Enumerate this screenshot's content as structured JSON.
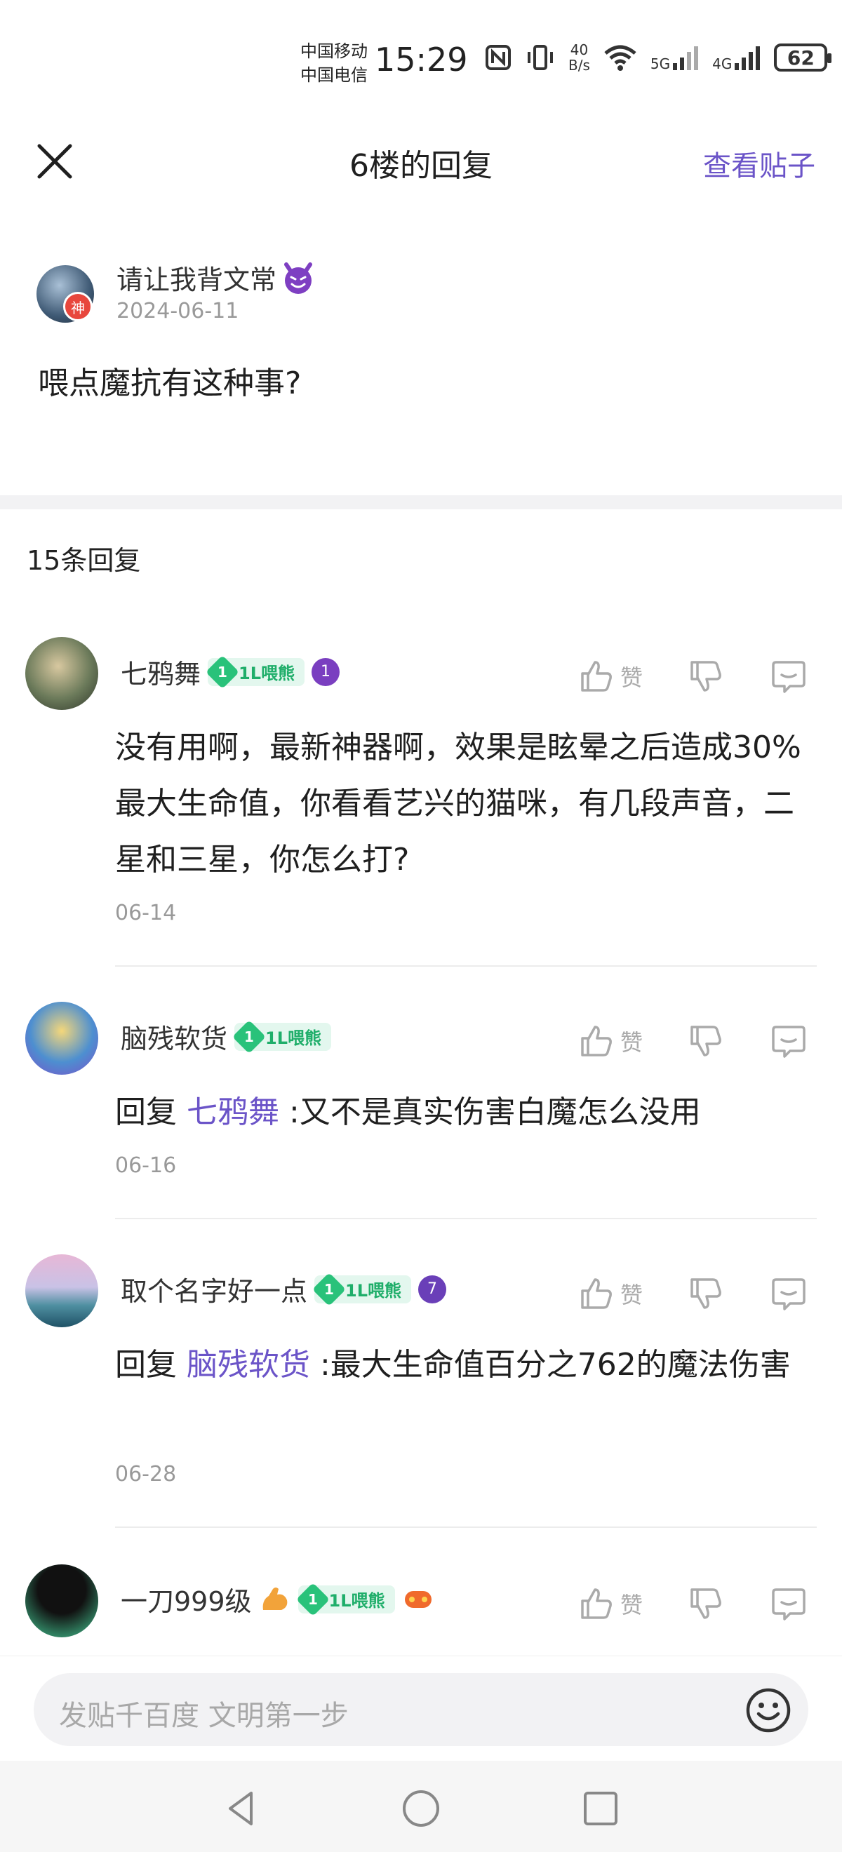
{
  "status_bar": {
    "carrier_1": "中国移动",
    "carrier_2": "中国电信",
    "time": "15:29",
    "net_speed_value": "40",
    "net_speed_unit": "B/s",
    "net_5g": "5G",
    "net_4g": "4G",
    "battery": "62"
  },
  "header": {
    "title": "6楼的回复",
    "view_post": "查看贴子"
  },
  "floor": {
    "author": "请让我背文常",
    "god_badge": "神",
    "date": "2024-06-11",
    "content": "喂点魔抗有这种事?"
  },
  "reply_count": "15条回复",
  "action_labels": {
    "like": "赞"
  },
  "replies": [
    {
      "name": "七鸦舞",
      "level_num": "1",
      "level_label": "1L喂熊",
      "medal": "1",
      "text": "没有用啊，最新神器啊，效果是眩晕之后造成30%最大生命值，你看看艺兴的猫咪，有几段声音，二星和三星，你怎么打?",
      "date": "06-14"
    },
    {
      "name": "脑残软货",
      "level_num": "1",
      "level_label": "1L喂熊",
      "reply_prefix": "回复 ",
      "reply_to": "七鸦舞",
      "text": " :又不是真实伤害白魔怎么没用",
      "date": "06-16"
    },
    {
      "name": "取个名字好一点",
      "level_num": "1",
      "level_label": "1L喂熊",
      "medal": "7",
      "reply_prefix": "回复 ",
      "reply_to": "脑残软货",
      "text": " :最大生命值百分之762的魔法伤害",
      "date": "06-28"
    },
    {
      "name": "一刀999级",
      "level_num": "1",
      "level_label": "1L喂熊"
    }
  ],
  "input": {
    "placeholder": "发贴千百度 文明第一步"
  },
  "colors": {
    "accent": "#6b54c8",
    "level_green": "#29c27a"
  }
}
